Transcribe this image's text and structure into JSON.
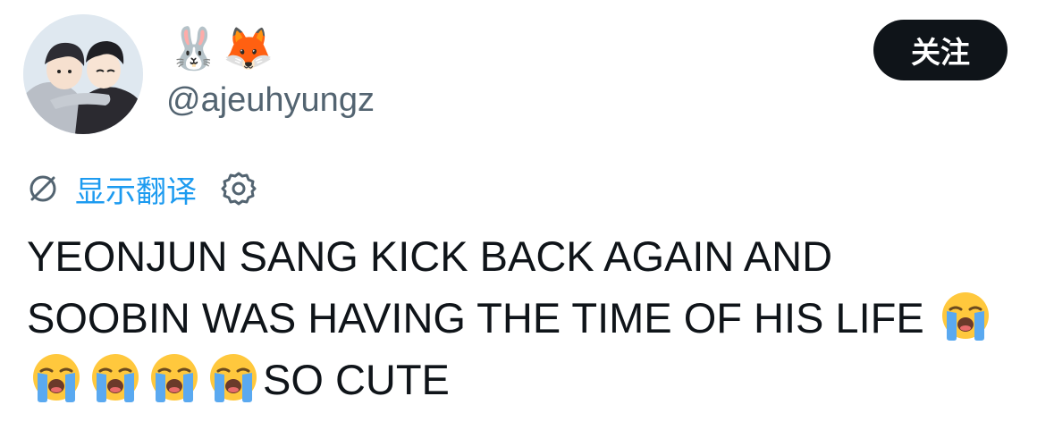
{
  "user": {
    "display_name": "🐰🦊",
    "handle": "@ajeuhyungz"
  },
  "follow_button": {
    "label": "关注"
  },
  "translation": {
    "link_label": "显示翻译"
  },
  "tweet": {
    "line1": "YEONJUN SANG KICK BACK AGAIN AND",
    "line2": "SOOBIN WAS HAVING THE TIME OF HIS LIFE",
    "line3_tail": "SO CUTE"
  },
  "colors": {
    "text": "#0f1419",
    "secondary": "#536471",
    "link": "#1d9bf0",
    "button_bg": "#0f1419"
  },
  "icons": [
    "avatar-illustration",
    "translate-icon",
    "gear-icon",
    "loudly-crying-face-emoji"
  ]
}
